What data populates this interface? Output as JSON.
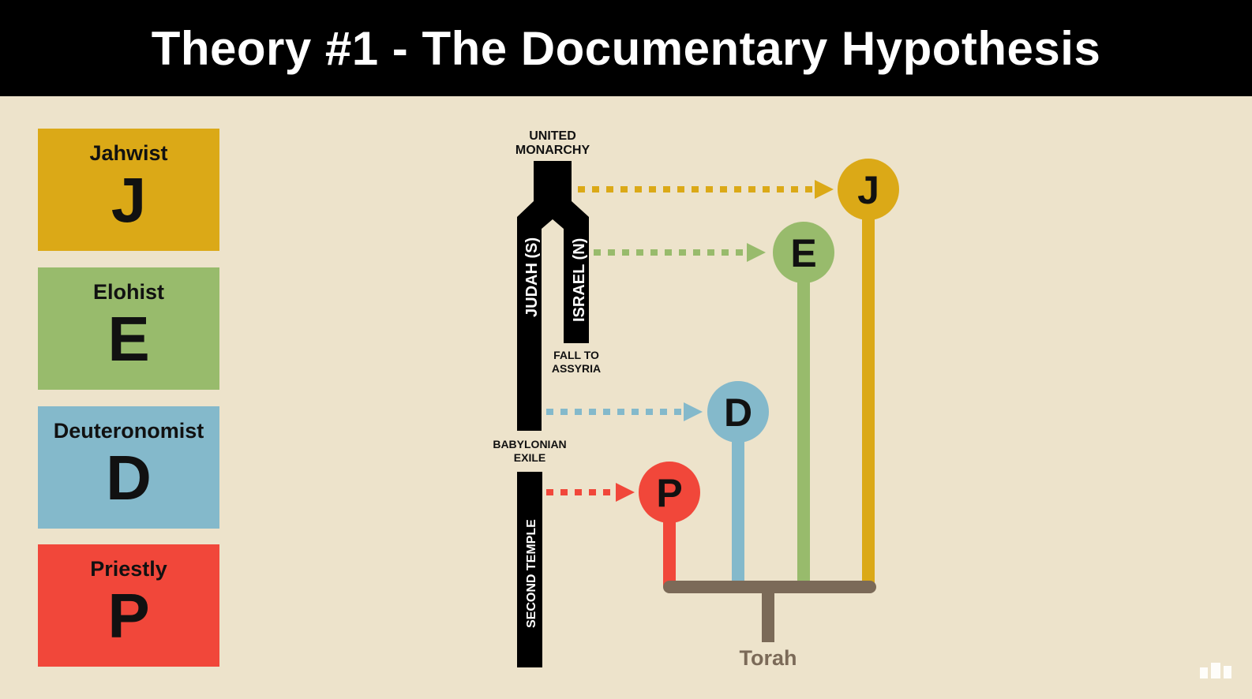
{
  "title": "Theory #1 - The Documentary Hypothesis",
  "sources": [
    {
      "id": "j",
      "name": "Jahwist",
      "letter": "J",
      "color": "#dba917"
    },
    {
      "id": "e",
      "name": "Elohist",
      "letter": "E",
      "color": "#98bb6c"
    },
    {
      "id": "d",
      "name": "Deuteronomist",
      "letter": "D",
      "color": "#84b9cb"
    },
    {
      "id": "p",
      "name": "Priestly",
      "letter": "P",
      "color": "#f1473a"
    }
  ],
  "timeline": {
    "united_monarchy": [
      "UNITED",
      "MONARCHY"
    ],
    "judah": "JUDAH (S)",
    "israel": "ISRAEL (N)",
    "fall_to_assyria": [
      "FALL TO",
      "ASSYRIA"
    ],
    "babylonian_exile": [
      "BABYLONIAN",
      "EXILE"
    ],
    "second_temple": "SECOND TEMPLE"
  },
  "torah_label": "Torah",
  "colors": {
    "background": "#ede3cb",
    "title_bar": "#000000",
    "torah": "#7b6a58"
  }
}
